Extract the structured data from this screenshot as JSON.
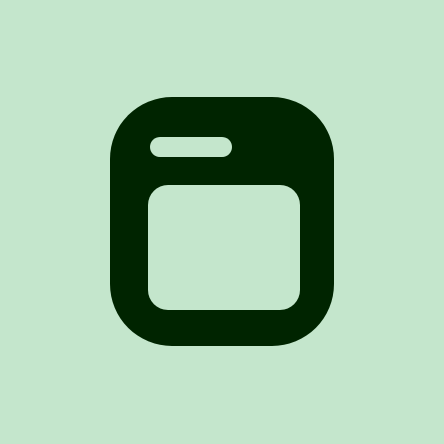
{
  "icon": {
    "name": "browser-window-icon"
  },
  "colors": {
    "background": "#c4e6cc",
    "icon_fill": "#002400",
    "cutout": "#c4e6cc"
  }
}
